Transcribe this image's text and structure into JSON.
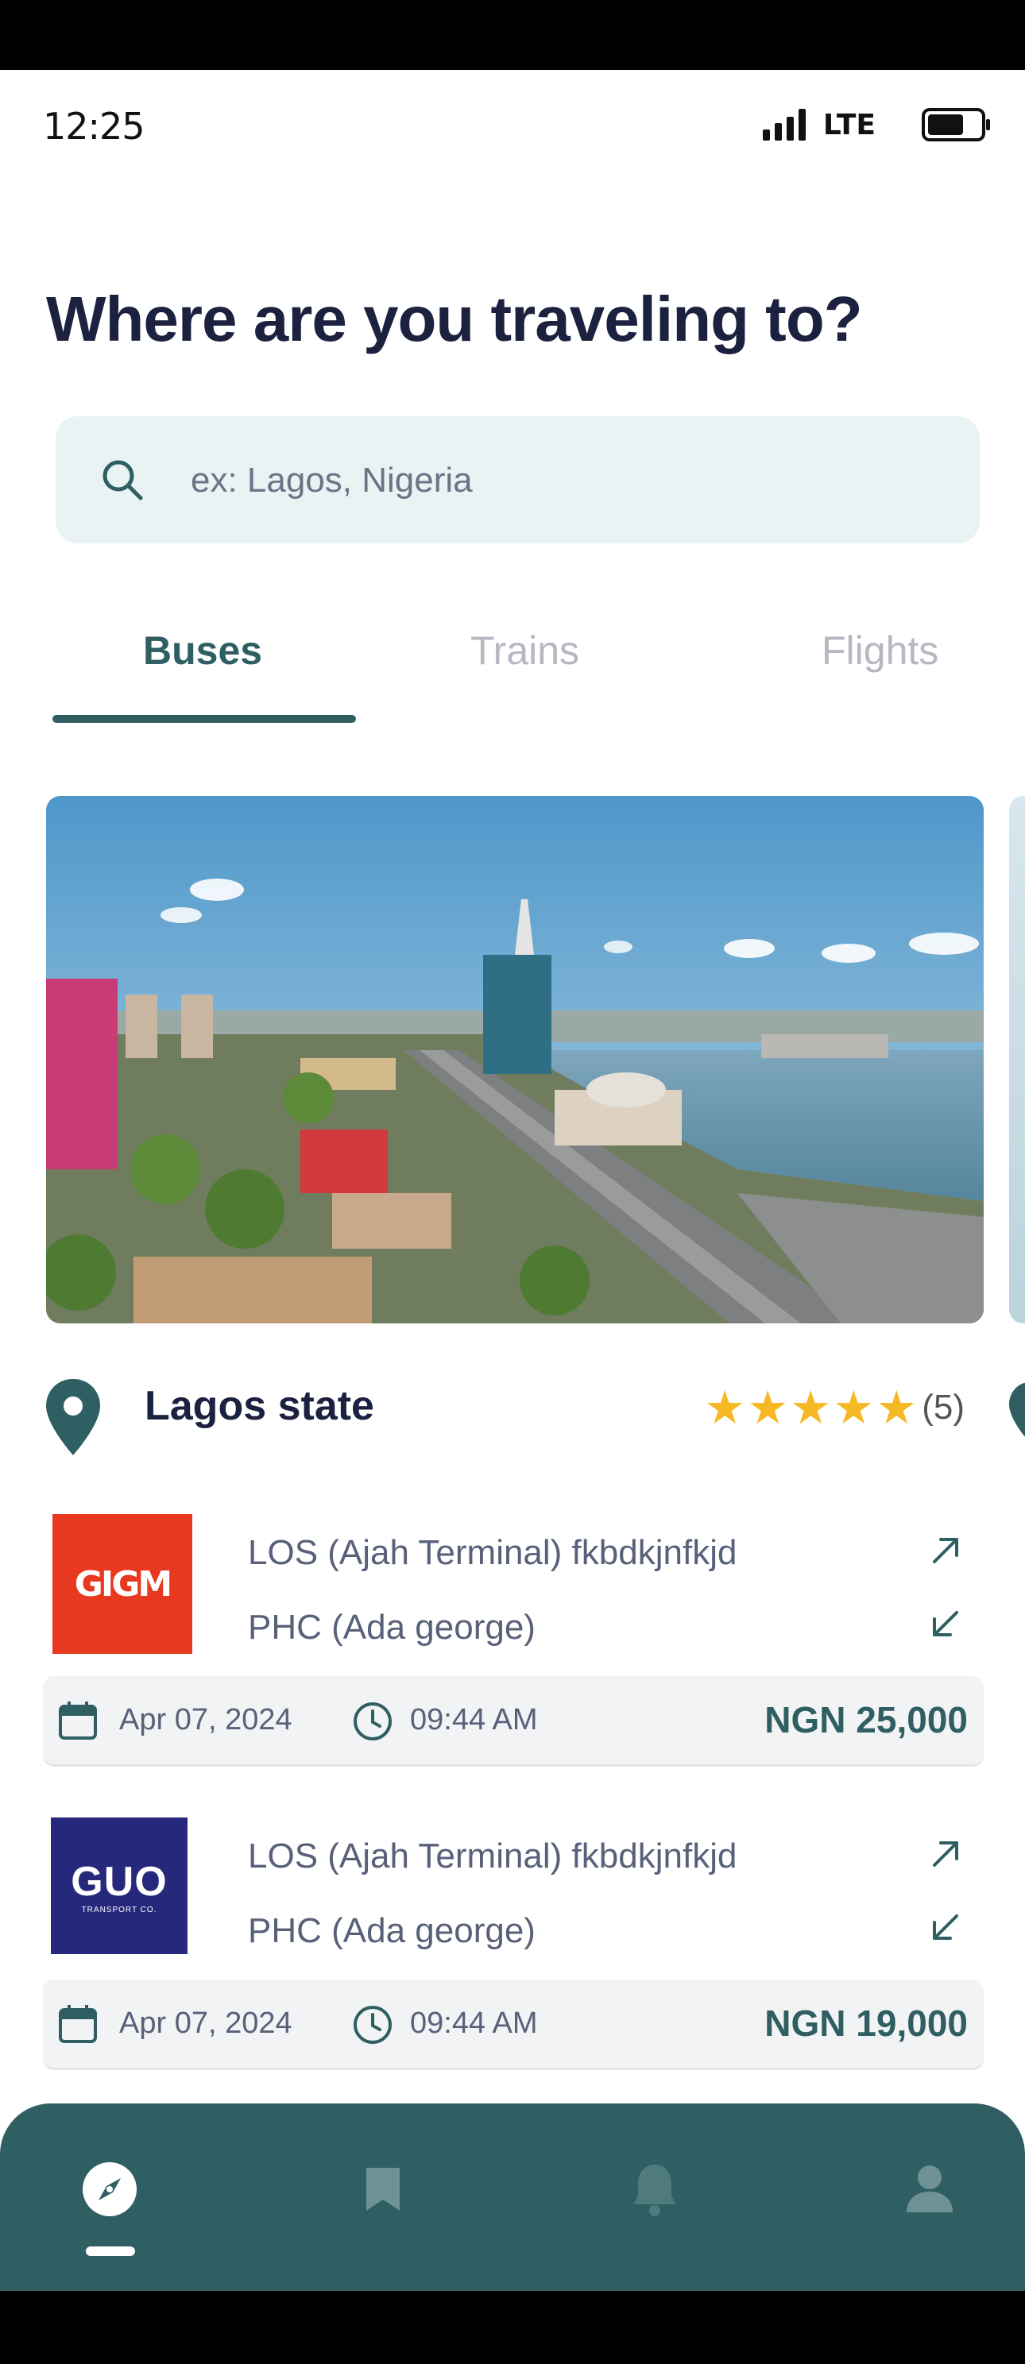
{
  "status_bar": {
    "time": "12:25",
    "network": "LTE"
  },
  "page_title": "Where are you traveling to?",
  "search": {
    "placeholder": "ex: Lagos, Nigeria"
  },
  "tabs": [
    {
      "label": "Buses",
      "active": true
    },
    {
      "label": "Trains",
      "active": false
    },
    {
      "label": "Flights",
      "active": false
    }
  ],
  "destination": {
    "name": "Lagos state",
    "rating_stars": 5,
    "rating_count": "(5)"
  },
  "trips": [
    {
      "operator_logo": "GIGM",
      "from": "LOS (Ajah Terminal) fkbdkjnfkjd",
      "to": "PHC (Ada george)",
      "date": "Apr 07, 2024",
      "time": "09:44 AM",
      "price": "NGN 25,000"
    },
    {
      "operator_logo": "GUO",
      "operator_logo_sub": "TRANSPORT CO.",
      "from": "LOS (Ajah Terminal) fkbdkjnfkjd",
      "to": "PHC (Ada george)",
      "date": "Apr 07, 2024",
      "time": "09:44 AM",
      "price": "NGN 19,000"
    }
  ],
  "bottom_nav": {
    "items": [
      "compass-icon",
      "bookmark-icon",
      "bell-icon",
      "profile-icon"
    ],
    "active": "compass-icon"
  },
  "colors": {
    "primary": "#2f5f62",
    "title": "#1c2140",
    "search_bg": "#e9f3f3",
    "star": "#f7b825",
    "gigm_red": "#e8381f",
    "guo_blue": "#26287b"
  }
}
